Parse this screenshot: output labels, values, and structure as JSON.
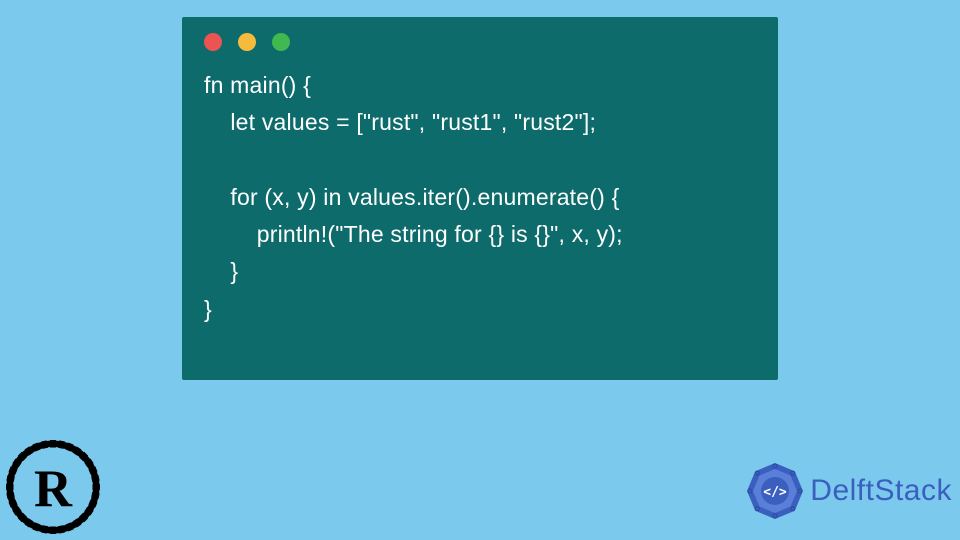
{
  "code_window": {
    "lines": [
      "fn main() {",
      "    let values = [\"rust\", \"rust1\", \"rust2\"];",
      "",
      "    for (x, y) in values.iter().enumerate() {",
      "        println!(\"The string for {} is {}\", x, y);",
      "    }",
      "}"
    ]
  },
  "branding": {
    "delftstack_label": "DelftStack"
  },
  "icons": {
    "rust_logo": "rust-logo",
    "delft_badge": "delftstack-badge"
  },
  "colors": {
    "background": "#7bcaee",
    "window": "#0e6b6b",
    "dot_red": "#ec5353",
    "dot_yellow": "#f6bb3c",
    "dot_green": "#3fb950",
    "delft_primary": "#3b5fbf"
  }
}
